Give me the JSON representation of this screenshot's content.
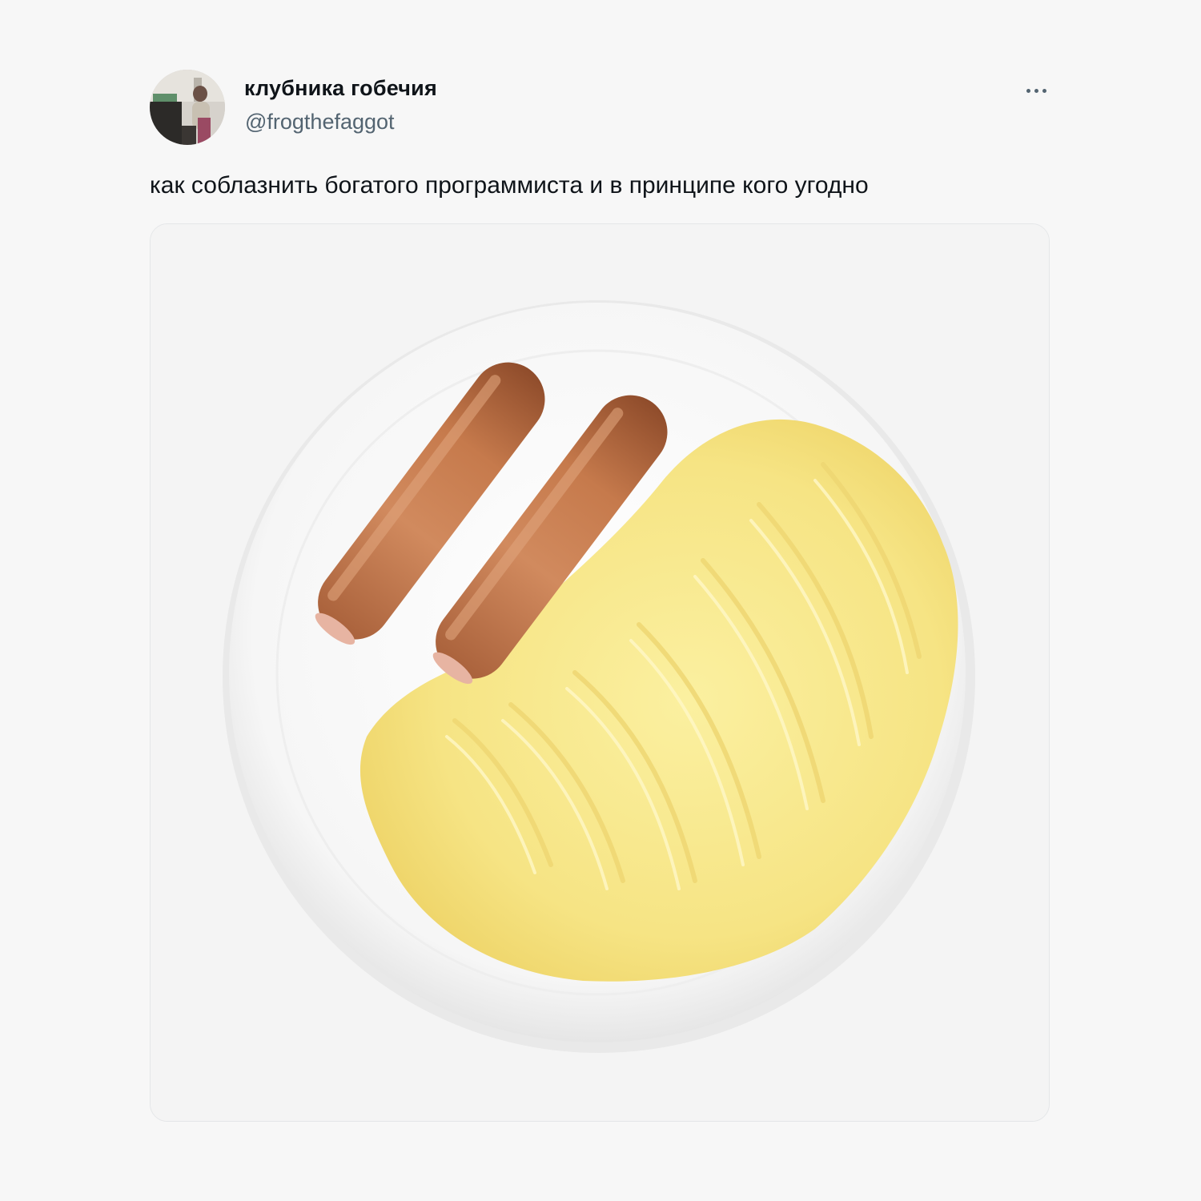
{
  "tweet": {
    "author": {
      "display_name": "клубника гобечия",
      "handle": "@frogthefaggot",
      "avatar": "user-avatar-photo"
    },
    "more_icon": "ellipsis-icon",
    "text": "как соблазнить богатого программиста и в принципе кого угодно",
    "media": {
      "kind": "photo",
      "subject": "plate with two sausages and mashed potatoes"
    }
  }
}
